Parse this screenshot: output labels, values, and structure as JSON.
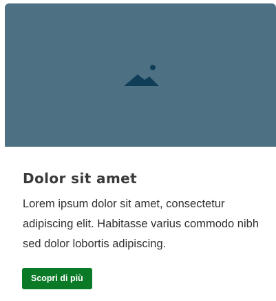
{
  "card": {
    "title": "Dolor sit amet",
    "text": "Lorem ipsum dolor sit amet, consectetur adipiscing elit. Habitasse varius commodo nibh sed dolor lobortis adipiscing.",
    "button_label": "Scopri di più",
    "image_icon": "image-placeholder-icon"
  },
  "colors": {
    "media_background": "#4d7182",
    "icon": "#103d58",
    "button": "#0a7a27",
    "title": "#3a3a3a",
    "text": "#303030"
  }
}
